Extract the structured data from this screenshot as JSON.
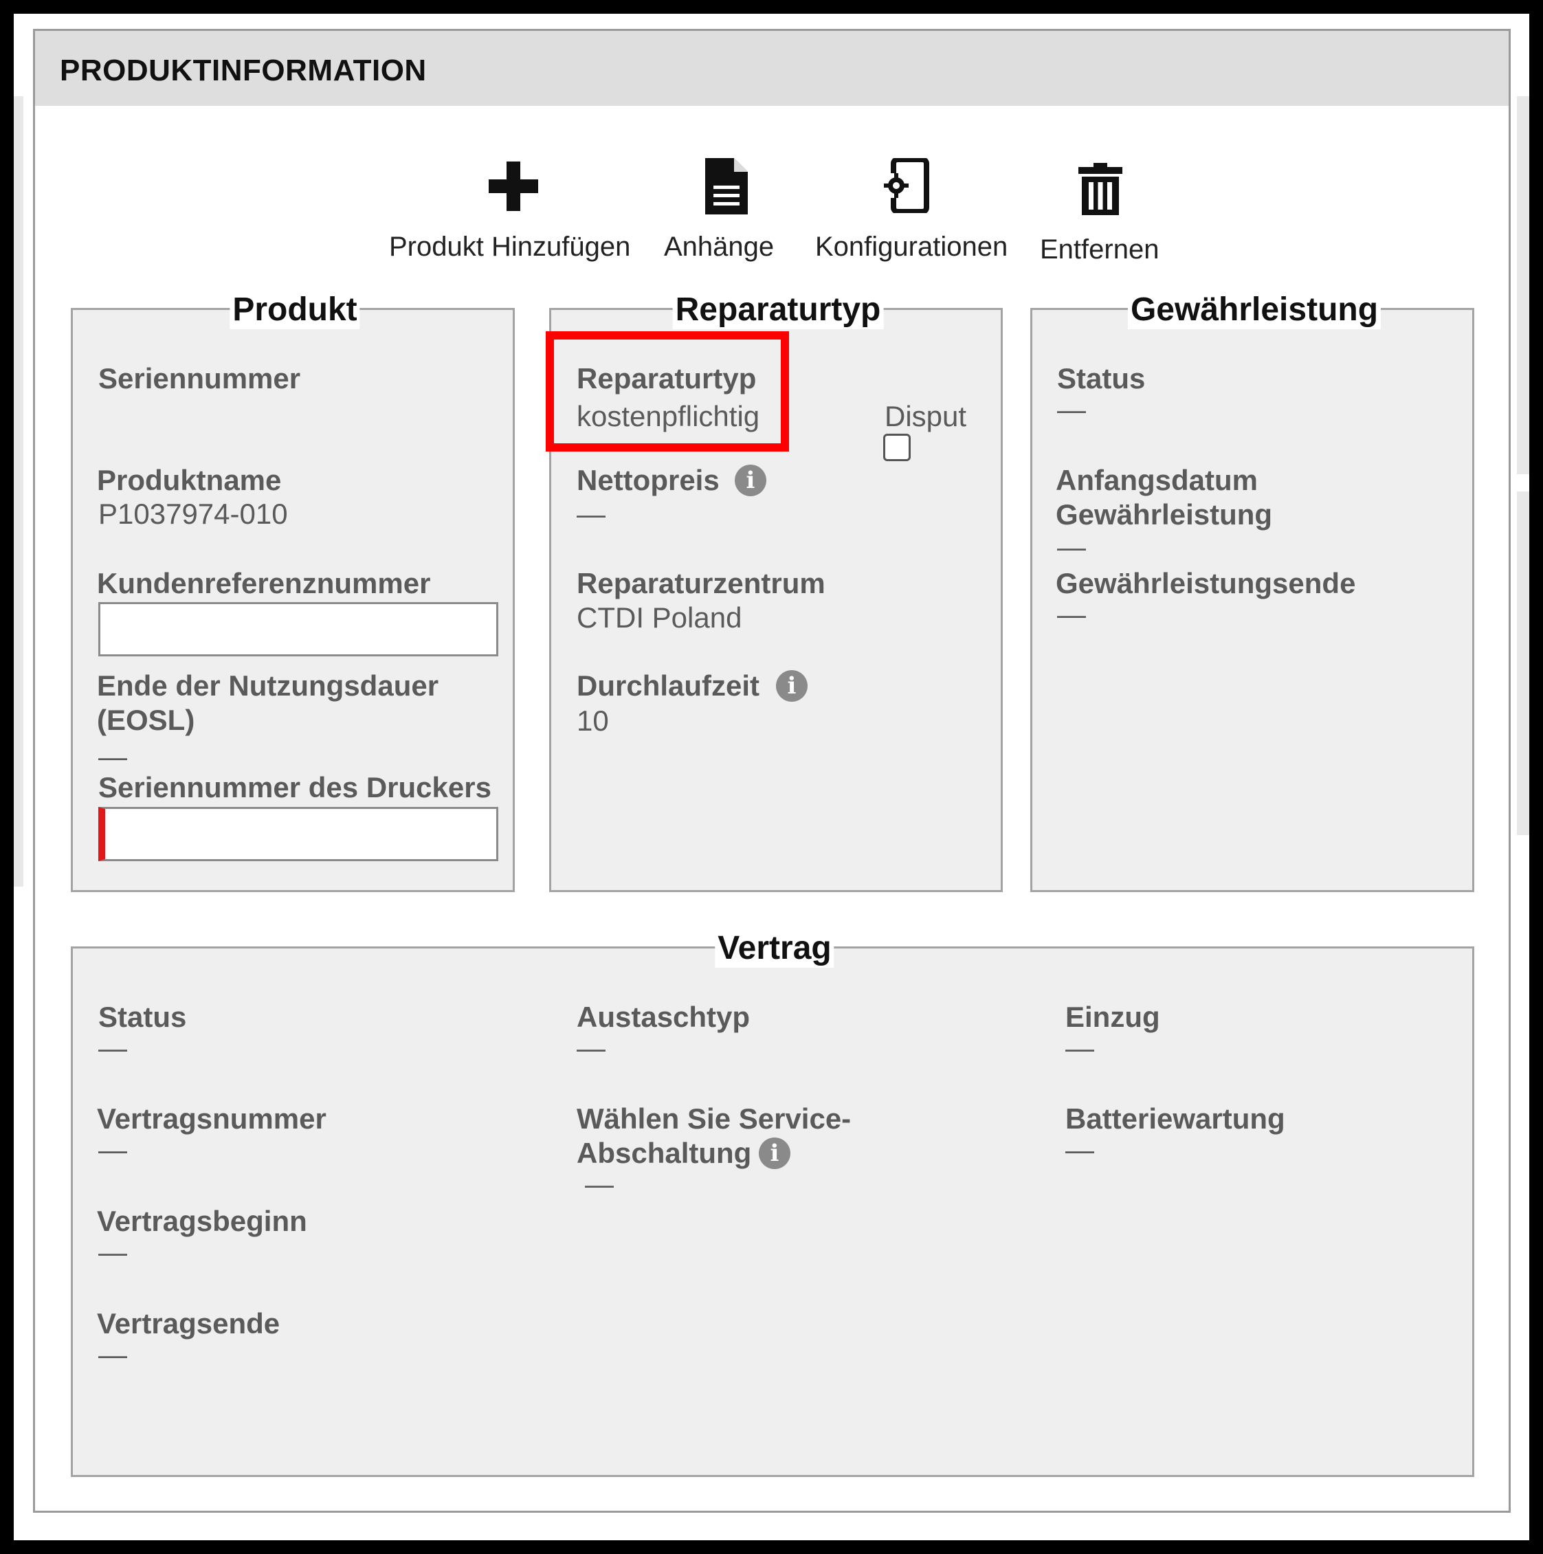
{
  "panel": {
    "title": "PRODUKTINFORMATION"
  },
  "toolbar": {
    "add_product": "Produkt Hinzufügen",
    "attachments": "Anhänge",
    "configurations": "Konfigurationen",
    "remove": "Entfernen"
  },
  "produkt": {
    "legend": "Produkt",
    "serial_label": "Seriennummer",
    "serial_value": "",
    "product_name_label": "Produktname",
    "product_name_value": "P1037974-010",
    "customer_ref_label": "Kundenreferenznummer",
    "customer_ref_value": "",
    "eosl_label_line1": "Ende der Nutzungsdauer",
    "eosl_label_line2": "(EOSL)",
    "eosl_value": "—",
    "printer_serial_label": "Seriennummer des Druckers",
    "printer_serial_value": ""
  },
  "reparaturtyp": {
    "legend": "Reparaturtyp",
    "type_label": "Reparaturtyp",
    "type_value": "kostenpflichtig",
    "dispute_label": "Disput",
    "dispute_checked": false,
    "net_price_label": "Nettopreis",
    "net_price_value": "—",
    "repair_center_label": "Reparaturzentrum",
    "repair_center_value": "CTDI Poland",
    "turnaround_label": "Durchlaufzeit",
    "turnaround_value": "10"
  },
  "gewaehrleistung": {
    "legend": "Gewährleistung",
    "status_label": "Status",
    "status_value": "—",
    "start_label_line1": "Anfangsdatum",
    "start_label_line2": "Gewährleistung",
    "start_value": "—",
    "end_label": "Gewährleistungsende",
    "end_value": "—"
  },
  "vertrag": {
    "legend": "Vertrag",
    "status_label": "Status",
    "status_value": "—",
    "number_label": "Vertragsnummer",
    "number_value": "—",
    "begin_label": "Vertragsbeginn",
    "begin_value": "—",
    "end_label": "Vertragsende",
    "end_value": "—",
    "exchange_type_label": "Austaschtyp",
    "exchange_type_value": "—",
    "service_shutdown_label_line1": "Wählen Sie Service-",
    "service_shutdown_label_line2": "Abschaltung",
    "service_shutdown_value": "—",
    "collection_label": "Einzug",
    "collection_value": "—",
    "battery_label": "Batteriewartung",
    "battery_value": "—"
  },
  "icons": {
    "info": "i",
    "add": "plus-icon",
    "attachments": "document-icon",
    "configurations": "device-gear-icon",
    "remove": "trash-icon"
  },
  "colors": {
    "highlight": "#ff0000",
    "required_marker": "#e01818",
    "header_bg": "#dedede",
    "fieldset_bg": "#efefef"
  }
}
